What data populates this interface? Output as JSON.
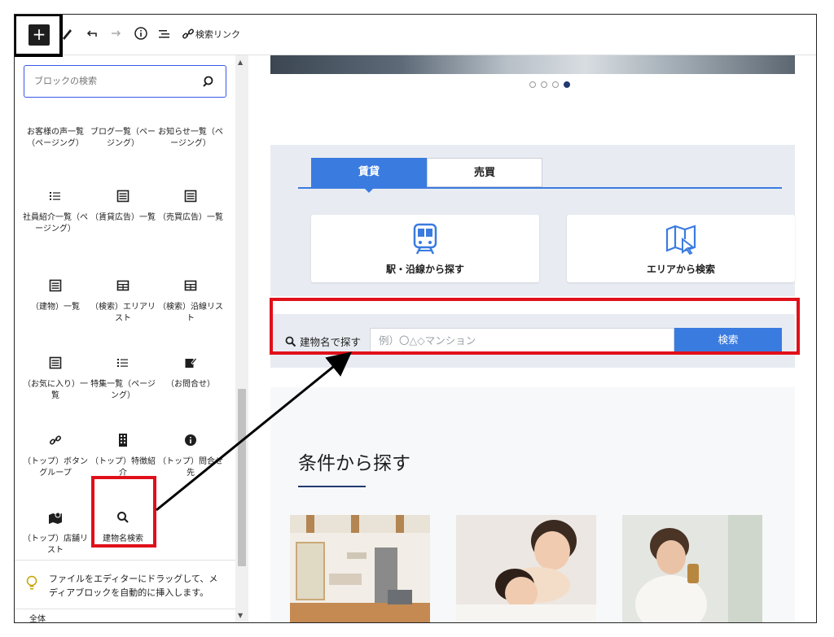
{
  "toolbar": {
    "add_block": "+",
    "link_label": "検索リンク"
  },
  "sidebar": {
    "search_placeholder": "ブロックの検索",
    "blocks": [
      {
        "label": "お客様の声一覧（ページング）",
        "icon": "none"
      },
      {
        "label": "ブログ一覧（ページング）",
        "icon": "none"
      },
      {
        "label": "お知らせ一覧（ページング）",
        "icon": "none"
      },
      {
        "label": "社員紹介一覧（ページング）",
        "icon": "list-icon"
      },
      {
        "label": "（賃貸広告）一覧",
        "icon": "document-icon"
      },
      {
        "label": "（売買広告）一覧",
        "icon": "document-icon"
      },
      {
        "label": "（建物）一覧",
        "icon": "document-icon"
      },
      {
        "label": "（検索）エリアリスト",
        "icon": "table-icon"
      },
      {
        "label": "（検索）沿線リスト",
        "icon": "table-icon"
      },
      {
        "label": "（お気に入り）一覧",
        "icon": "document-icon"
      },
      {
        "label": "特集一覧（ページング）",
        "icon": "list-icon"
      },
      {
        "label": "（お問合せ）",
        "icon": "edit-icon"
      },
      {
        "label": "（トップ）ボタングループ",
        "icon": "link-icon"
      },
      {
        "label": "（トップ）特徴紹介",
        "icon": "building-icon"
      },
      {
        "label": "（トップ）問合せ先",
        "icon": "info-icon"
      },
      {
        "label": "（トップ）店舗リスト",
        "icon": "map-pin-icon"
      },
      {
        "label": "建物名検索",
        "icon": "search-icon"
      }
    ],
    "hint": "ファイルをエディターにドラッグして、メディアブロックを自動的に挿入します。",
    "breadcrumb": "全体"
  },
  "canvas": {
    "tabs": [
      "賃貸",
      "売買"
    ],
    "options": [
      "駅・沿線から探す",
      "エリアから検索"
    ],
    "name_search": {
      "label": "建物名で探す",
      "placeholder": "例）〇△◇マンション",
      "button": "検索"
    },
    "conditions_title": "条件から探す"
  },
  "colors": {
    "accent_blue": "#3a7be0",
    "annotation_red": "#e0101a",
    "navy": "#223a70"
  }
}
